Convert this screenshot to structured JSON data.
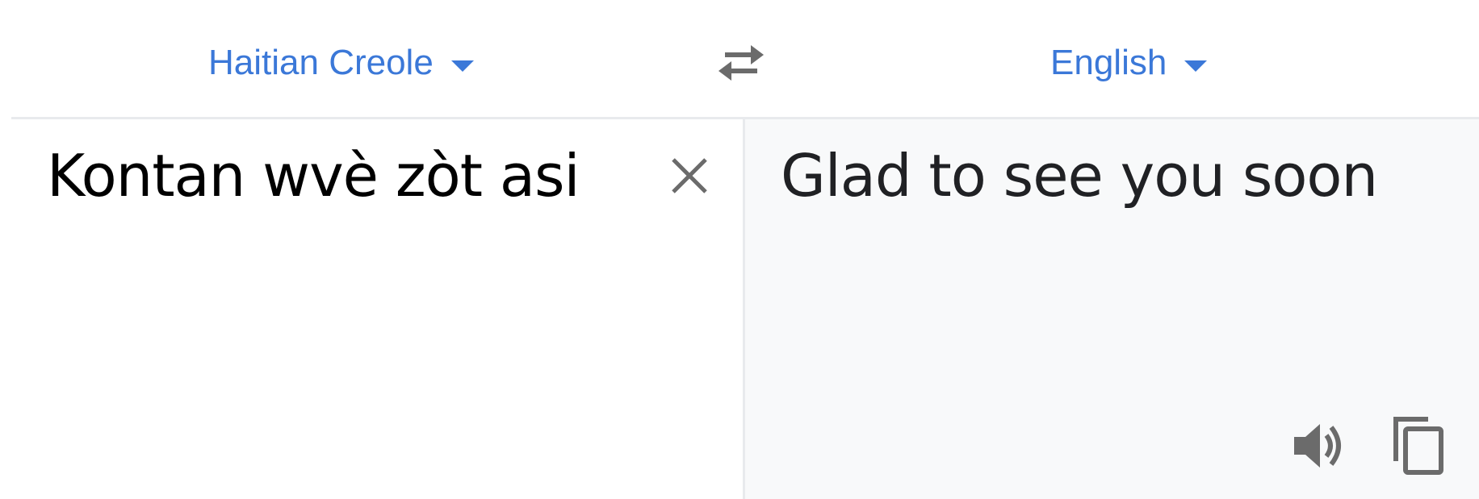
{
  "language_bar": {
    "source_language": "Haitian Creole",
    "target_language": "English",
    "swap_icon": "swap-arrows-icon"
  },
  "source": {
    "text": "Kontan wvè zòt asi",
    "clear_icon": "close-icon"
  },
  "target": {
    "text": "Glad to see you soon",
    "speaker_icon": "speaker-icon",
    "copy_icon": "copy-icon"
  },
  "colors": {
    "accent": "#3b78d8",
    "icon_gray": "#6b6b6b",
    "target_bg": "#f8f9fa",
    "divider": "#e8eaed"
  }
}
